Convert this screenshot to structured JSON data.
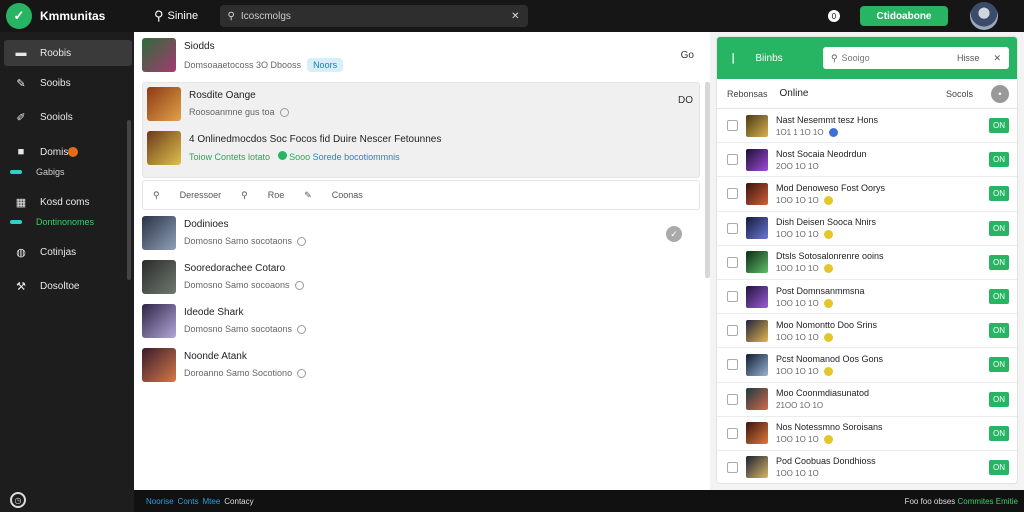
{
  "topbar": {
    "logo_glyph": "✓",
    "brand": "Kmmunitas",
    "search_label": "Sinine",
    "search_value": "Icoscmolgs",
    "notif_count": "0",
    "cta_label": "Ctidoabone"
  },
  "sidebar": {
    "items": [
      {
        "label": "Roobis",
        "icon": "home-icon",
        "glyph": "▬"
      },
      {
        "label": "Sooibs",
        "icon": "pen-icon",
        "glyph": "✎"
      },
      {
        "label": "Sooiols",
        "icon": "brush-icon",
        "glyph": "✐"
      },
      {
        "label": "Domiste",
        "icon": "square-icon",
        "glyph": "■"
      },
      {
        "label": "Kosd coms",
        "icon": "grid-icon",
        "glyph": "▦"
      },
      {
        "label": "Cotinjas",
        "icon": "globe-icon",
        "glyph": "◍"
      },
      {
        "label": "Dosoltoe",
        "icon": "tool-icon",
        "glyph": "⚒"
      }
    ],
    "sub_items": [
      "Gabigs",
      "Dontinonomes"
    ]
  },
  "main": {
    "rows": [
      {
        "title": "Siodds",
        "meta": "Domsoaaetocoss 3O Dbooss",
        "chip": "Noors",
        "right": "Go",
        "c1": "#2f6b3b",
        "c2": "#a43b6f"
      },
      {
        "title": "Rosdite Oange",
        "meta": "Roosoanmne gus toa",
        "right": "DO",
        "c1": "#8c3a14",
        "c2": "#e2a24a"
      },
      {
        "title": "4 Onlinedmocdos Soc Focos fid Duire Nescer Fetounnes",
        "meta_green": "Toiow Contets lotato",
        "meta_green2": "Sooo",
        "meta_blue": "Sorede bocotiommnis",
        "c1": "#6b3a1c",
        "c2": "#e0c14a"
      }
    ],
    "filters": [
      "Deressoer",
      "Roe",
      "Coonas"
    ],
    "list": [
      {
        "title": "Dodinioes",
        "meta": "Domosno Samo socotaons",
        "c1": "#2a3347",
        "c2": "#8fa0b6"
      },
      {
        "title": "Sooredorachee Cotaro",
        "meta": "Domosno Samo socoaons",
        "c1": "#2b2b2b",
        "c2": "#6f7a70"
      },
      {
        "title": "Ideode Shark",
        "meta": "Domosno Samo socotaons",
        "c1": "#2e2548",
        "c2": "#b2a7d8"
      },
      {
        "title": "Noonde Atank",
        "meta": "Doroanno Samo Socotiono",
        "c1": "#3a1b2a",
        "c2": "#d37a4a"
      }
    ]
  },
  "panel": {
    "title": "Biinbs",
    "search_placeholder": "Sooigo",
    "search_hint": "Hisse",
    "tab1": "Rebonsas",
    "tab2": "Online",
    "tab3": "Socols",
    "friends": [
      {
        "name": "Nast Nesemmt tesz Hons",
        "meta": "1O1 1 1O 1O",
        "btn": "ON",
        "c1": "#4a3b12",
        "c2": "#d8b052",
        "coin": "blue"
      },
      {
        "name": "Nost Socaia  Neodrdun",
        "meta": "2OO 1O 1O",
        "btn": "ON",
        "c1": "#1a1033",
        "c2": "#a24bd8",
        "coin": "none"
      },
      {
        "name": "Mod Denoweso Fost Oorys",
        "meta": "1OO 1O 1O",
        "btn": "ON",
        "c1": "#3a120e",
        "c2": "#d0603c",
        "coin": "yellow"
      },
      {
        "name": "Dish Deisen Sooca Nnirs",
        "meta": "1OO 1O 1O",
        "btn": "ON",
        "c1": "#161a3a",
        "c2": "#6b79d6",
        "coin": "yellow"
      },
      {
        "name": "Dtsls Sotosalonrenre ooins",
        "meta": "1OO 1O 1O",
        "btn": "ON",
        "c1": "#0f2a16",
        "c2": "#5fbf6a",
        "coin": "yellow"
      },
      {
        "name": "Post Domnsanmmsna",
        "meta": "1OO 1O 1O",
        "btn": "ON",
        "c1": "#24123d",
        "c2": "#9a5ed6",
        "coin": "yellow"
      },
      {
        "name": "Moo Nomontto Doo Srins",
        "meta": "1OO 1O 1O",
        "btn": "ON",
        "c1": "#1f2340",
        "c2": "#e3b84a",
        "coin": "yellow"
      },
      {
        "name": "Pcst Noomanod Oos Gons",
        "meta": "1OO 1O 1O",
        "btn": "ON",
        "c1": "#0f1c2e",
        "c2": "#9ab3d6",
        "coin": "yellow"
      },
      {
        "name": "Moo Coonmdiasunatod",
        "meta": "21OO 1O 1O",
        "btn": "ON",
        "c1": "#1d3a3f",
        "c2": "#d36a4a",
        "coin": "none"
      },
      {
        "name": "Nos Notessmno Soroisans",
        "meta": "1OO 1O 1O",
        "btn": "ON",
        "c1": "#3a150f",
        "c2": "#e07a3a",
        "coin": "yellow"
      },
      {
        "name": "Pod Coobuas Dondhioss",
        "meta": "1OO 1O 1O",
        "btn": "ON",
        "c1": "#1a2030",
        "c2": "#d8b56a",
        "coin": "none"
      }
    ]
  },
  "footer": {
    "links": [
      "Noorise",
      "Conts",
      "Mtee"
    ],
    "label": "Contacy",
    "right1": "Foo foo obses",
    "right2": "Commites",
    "right3": "Emitie"
  },
  "colors": {
    "accent": "#27b463",
    "dark": "#161616",
    "link": "#2486c6"
  }
}
